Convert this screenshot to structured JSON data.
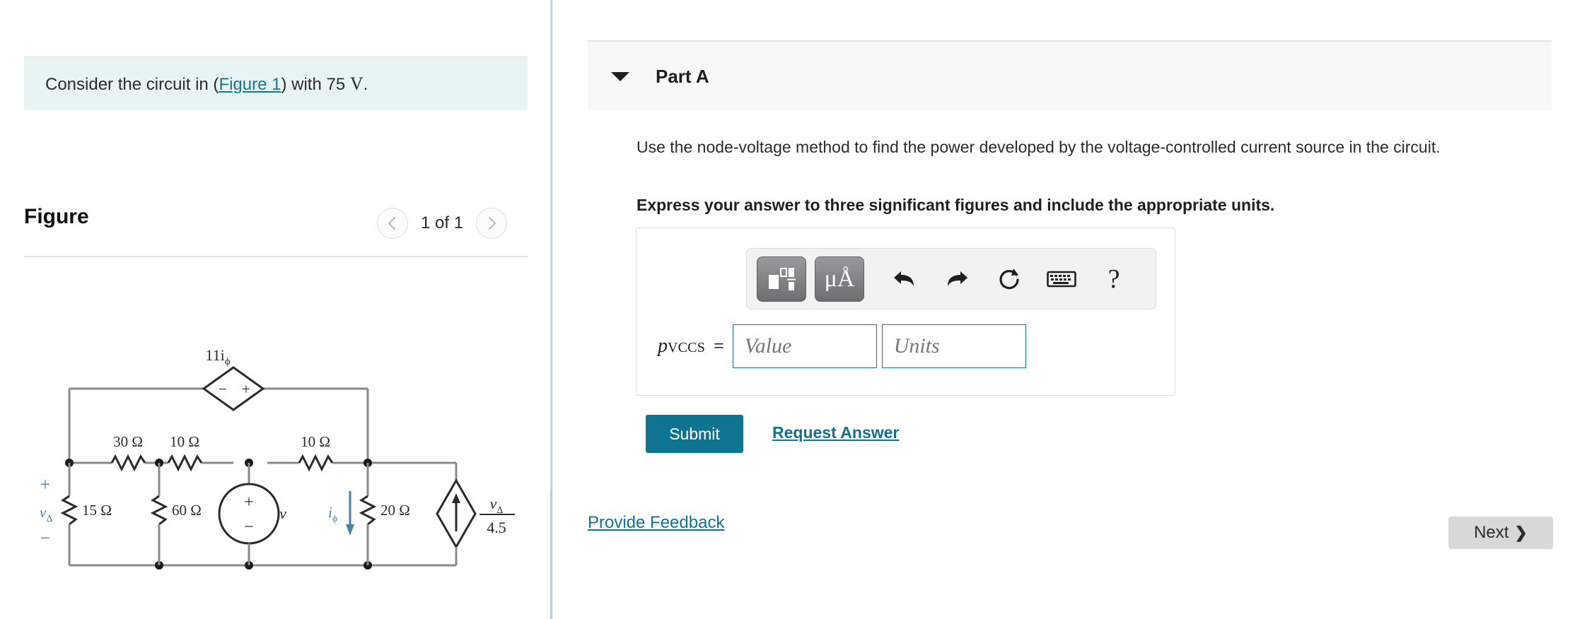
{
  "left": {
    "statement": {
      "prefix": "Consider the circuit in (",
      "link": "Figure 1",
      "middle": ") with 75 ",
      "unit": "V",
      "suffix": "."
    },
    "figure": {
      "title": "Figure",
      "count_label": "1 of 1",
      "prev_icon": "chevron-left-icon",
      "next_icon": "chevron-right-icon"
    },
    "circuit": {
      "dependent_source_label": "11i",
      "dependent_source_sub": "ϕ",
      "dependent_source_minus": "−",
      "dependent_source_plus": "+",
      "r1": "30 Ω",
      "r2": "10 Ω",
      "r3": "10 Ω",
      "r4": "15 Ω",
      "r5": "60 Ω",
      "r6": "20 Ω",
      "v_delta": "v",
      "v_delta_sub": "Δ",
      "plus_sign": "+",
      "minus_sign": "−",
      "source_v": "v",
      "source_plus": "+",
      "source_minus": "−",
      "i_phi": "i",
      "i_phi_sub": "ϕ",
      "ccs_num": "v",
      "ccs_num_sub": "Δ",
      "ccs_den": "4.5"
    }
  },
  "right": {
    "part": {
      "label": "Part A",
      "caret_icon": "caret-down-icon"
    },
    "question": "Use the node-voltage method to find the power developed by the voltage-controlled current source in the circuit.",
    "instruction": "Express your answer to three significant figures and include the appropriate units.",
    "toolbar": {
      "items": [
        {
          "name": "template-icon",
          "glyph": ""
        },
        {
          "name": "units-micro-angstrom-icon",
          "glyph": "μÅ"
        },
        {
          "name": "undo-icon",
          "glyph": "↶"
        },
        {
          "name": "redo-icon",
          "glyph": "↷"
        },
        {
          "name": "reset-icon",
          "glyph": "↻"
        },
        {
          "name": "keyboard-icon",
          "glyph": "⌨"
        },
        {
          "name": "help-icon",
          "glyph": "?"
        }
      ]
    },
    "answer": {
      "symbol": "p",
      "symbol_sub": "VCCS",
      "equals": "=",
      "value_placeholder": "Value",
      "units_placeholder": "Units"
    },
    "submit_label": "Submit",
    "request_answer_label": "Request Answer",
    "provide_feedback_label": "Provide Feedback",
    "next_label": "Next",
    "next_chevron": "❯"
  },
  "colors": {
    "accent": "#0e7490",
    "statement_bg": "#e8f4f3",
    "header_bg": "#f8f8f8",
    "circuit_wire": "#8a8a8a",
    "circuit_annotation": "#4a80a8",
    "next_bg": "#d8d8d8"
  }
}
